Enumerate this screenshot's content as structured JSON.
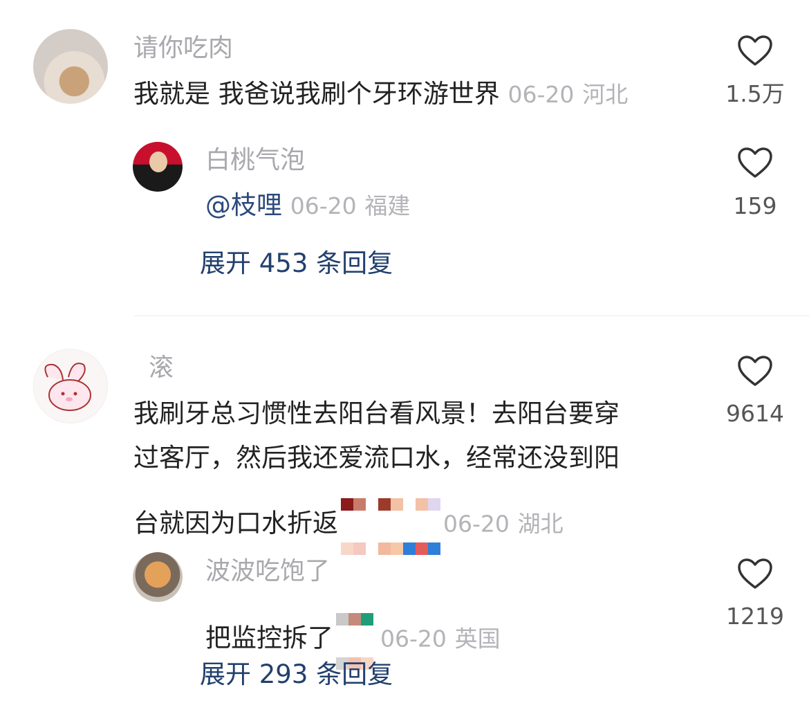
{
  "comments": [
    {
      "username": "请你吃肉",
      "text": "我就是 我爸说我刷个牙环游世界",
      "date": "06-20",
      "location": "河北",
      "likes": "1.5万",
      "reply": {
        "username": "白桃气泡",
        "mention": "@枝哩",
        "date": "06-20",
        "location": "福建",
        "likes": "159"
      },
      "expand_label": "展开 453 条回复"
    },
    {
      "username": "滚",
      "text_line1": "我刷牙总习惯性去阳台看风景！去阳台要穿",
      "text_line2": "过客厅，然后我还爱流口水，经常还没到阳",
      "text_line3": "台就因为口水折返",
      "date_partial": "06-20",
      "location": "湖北",
      "likes": "9614",
      "reply": {
        "username": "波波吃饱了",
        "text": "把监控拆了",
        "date": "06-20",
        "location": "英国",
        "likes": "1219"
      },
      "expand_label": "展开 293 条回复"
    }
  ],
  "icons": {
    "like": "heart-outline-icon"
  },
  "colors": {
    "link": "#22406e",
    "meta": "#b3b3b8",
    "name": "#a8a8ad"
  }
}
